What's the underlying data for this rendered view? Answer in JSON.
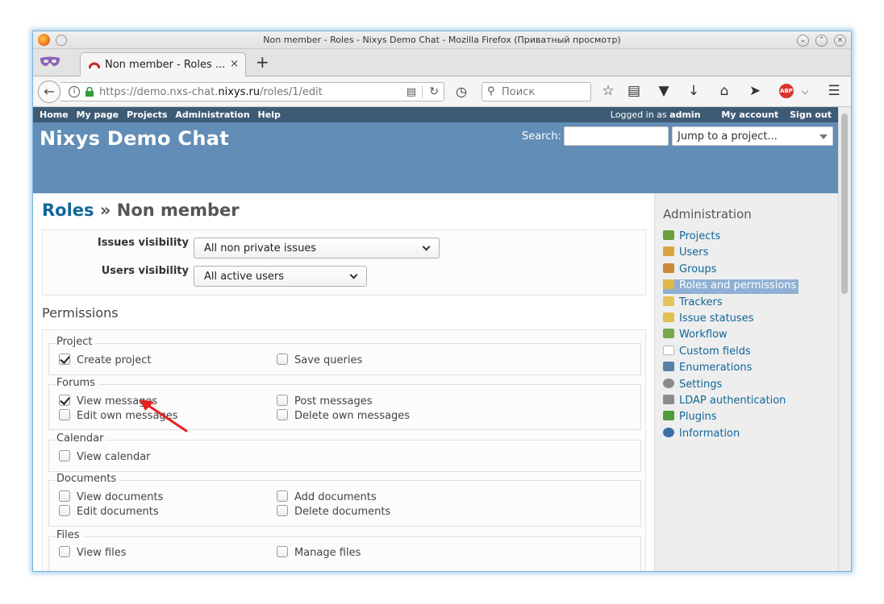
{
  "window": {
    "title": "Non member - Roles - Nixys Demo Chat - Mozilla Firefox (Приватный просмотр)"
  },
  "tab": {
    "title": "Non member - Roles ...",
    "close": "×",
    "new_tab": "+"
  },
  "navbar": {
    "url_prefix": "https://demo.nxs-chat.",
    "url_domain": "nixys.ru",
    "url_path": "/roles/1/edit",
    "search_placeholder": "Поиск",
    "abp_label": "ABP"
  },
  "topmenu": {
    "items": [
      "Home",
      "My page",
      "Projects",
      "Administration",
      "Help"
    ],
    "logged_in_prefix": "Logged in as",
    "user": "admin",
    "my_account": "My account",
    "sign_out": "Sign out"
  },
  "header": {
    "site_title": "Nixys Demo Chat",
    "search_label": "Search:",
    "jump_placeholder": "Jump to a project..."
  },
  "content": {
    "breadcrumb_link": "Roles",
    "breadcrumb_sep": " » ",
    "role_name": "Non member",
    "issues_visibility_label": "Issues visibility",
    "issues_visibility_value": "All non private issues",
    "users_visibility_label": "Users visibility",
    "users_visibility_value": "All active users",
    "permissions_title": "Permissions",
    "groups": [
      {
        "title": "Project",
        "items": [
          {
            "label": "Create project",
            "checked": true
          },
          {
            "label": "Save queries",
            "checked": false
          }
        ]
      },
      {
        "title": "Forums",
        "items": [
          {
            "label": "View messages",
            "checked": true
          },
          {
            "label": "Post messages",
            "checked": false
          },
          {
            "label": "Edit own messages",
            "checked": false
          },
          {
            "label": "Delete own messages",
            "checked": false
          }
        ]
      },
      {
        "title": "Calendar",
        "items": [
          {
            "label": "View calendar",
            "checked": false
          }
        ]
      },
      {
        "title": "Documents",
        "items": [
          {
            "label": "View documents",
            "checked": false
          },
          {
            "label": "Add documents",
            "checked": false
          },
          {
            "label": "Edit documents",
            "checked": false
          },
          {
            "label": "Delete documents",
            "checked": false
          }
        ]
      },
      {
        "title": "Files",
        "items": [
          {
            "label": "View files",
            "checked": false
          },
          {
            "label": "Manage files",
            "checked": false
          }
        ]
      }
    ]
  },
  "sidebar": {
    "title": "Administration",
    "items": [
      {
        "label": "Projects",
        "icon": "projects-icon",
        "color": "#6a9e3f"
      },
      {
        "label": "Users",
        "icon": "user-icon",
        "color": "#d9a441"
      },
      {
        "label": "Groups",
        "icon": "group-icon",
        "color": "#c98a3a"
      },
      {
        "label": "Roles and permissions",
        "icon": "key-icon",
        "color": "#e0b84a",
        "selected": true
      },
      {
        "label": "Trackers",
        "icon": "ticket-icon",
        "color": "#e7c25a"
      },
      {
        "label": "Issue statuses",
        "icon": "status-icon",
        "color": "#e3c04c"
      },
      {
        "label": "Workflow",
        "icon": "workflow-icon",
        "color": "#7aa94b"
      },
      {
        "label": "Custom fields",
        "icon": "custom-fields-icon",
        "color": "#ffffff"
      },
      {
        "label": "Enumerations",
        "icon": "list-icon",
        "color": "#5a7fa8"
      },
      {
        "label": "Settings",
        "icon": "gear-icon",
        "color": "#8a8a8a"
      },
      {
        "label": "LDAP authentication",
        "icon": "ldap-icon",
        "color": "#8c8c8c"
      },
      {
        "label": "Plugins",
        "icon": "plugin-icon",
        "color": "#4f9d3a"
      },
      {
        "label": "Information",
        "icon": "info-icon",
        "color": "#3a6ea8"
      }
    ]
  },
  "colors": {
    "topmenu": "#3e5b76",
    "header": "#628db6",
    "link": "#116699",
    "annotation_arrow": "#e8211f"
  }
}
